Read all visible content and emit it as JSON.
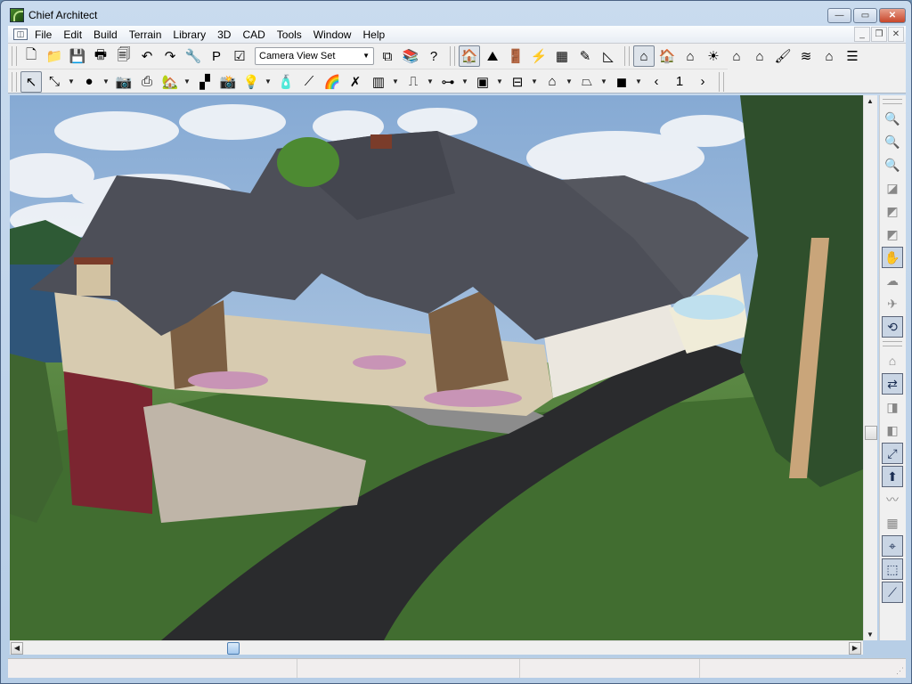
{
  "window": {
    "title": "Chief Architect",
    "controls": {
      "minimize": "—",
      "maximize": "▭",
      "close": "✕"
    }
  },
  "menubar": {
    "system_icon": "◫",
    "items": [
      "File",
      "Edit",
      "Build",
      "Terrain",
      "Library",
      "3D",
      "CAD",
      "Tools",
      "Window",
      "Help"
    ],
    "mdi_controls": {
      "minimize": "_",
      "restore": "❐",
      "close": "✕"
    }
  },
  "toolbar_row1": {
    "left_tools": [
      {
        "name": "new-plan",
        "glyph": "🗋"
      },
      {
        "name": "open-plan",
        "glyph": "📁"
      },
      {
        "name": "save",
        "glyph": "💾"
      },
      {
        "name": "print",
        "glyph": "🖶"
      },
      {
        "name": "print-preview",
        "glyph": "🗐"
      },
      {
        "name": "undo",
        "glyph": "↶"
      },
      {
        "name": "redo",
        "glyph": "↷"
      },
      {
        "name": "preferences",
        "glyph": "🔧"
      },
      {
        "name": "plan-layout",
        "glyph": "P"
      },
      {
        "name": "checklist",
        "glyph": "☑"
      }
    ],
    "view_set_combo": "Camera View Set",
    "combo_arrow": "▼",
    "after_combo": [
      {
        "name": "layer-display",
        "glyph": "⧉"
      },
      {
        "name": "library-browser",
        "glyph": "📚"
      },
      {
        "name": "help",
        "glyph": "?"
      }
    ],
    "build_tools": [
      {
        "name": "floor-plan",
        "glyph": "🏠",
        "selected": true
      },
      {
        "name": "terrain-plan",
        "glyph": "⛰"
      },
      {
        "name": "cabinet-plan",
        "glyph": "🚪"
      },
      {
        "name": "electrical-plan",
        "glyph": "⚡"
      },
      {
        "name": "materials-plan",
        "glyph": "▦"
      },
      {
        "name": "cad-plan",
        "glyph": "✎"
      },
      {
        "name": "cad-detail",
        "glyph": "◺"
      }
    ],
    "view_tools": [
      {
        "name": "camera-view",
        "glyph": "⌂",
        "selected": true
      },
      {
        "name": "full-overview",
        "glyph": "🏠"
      },
      {
        "name": "glass-house",
        "glyph": "⌂"
      },
      {
        "name": "raytrace-view",
        "glyph": "☀"
      },
      {
        "name": "doll-house",
        "glyph": "⌂"
      },
      {
        "name": "elevation-view",
        "glyph": "⌂"
      },
      {
        "name": "render-paint",
        "glyph": "🖌"
      },
      {
        "name": "water-render",
        "glyph": "≋"
      },
      {
        "name": "line-drawing",
        "glyph": "⌂"
      },
      {
        "name": "materials-list",
        "glyph": "☰"
      }
    ]
  },
  "toolbar_row2": {
    "tools": [
      {
        "name": "select-objects",
        "glyph": "↖",
        "selected": true
      },
      {
        "name": "edit-tools",
        "glyph": "⤡",
        "dropdown": true
      },
      {
        "name": "color-material",
        "glyph": "●",
        "dropdown": true
      },
      {
        "name": "camera-save",
        "glyph": "📷"
      },
      {
        "name": "printer-setup",
        "glyph": "⎙"
      },
      {
        "name": "house-tools",
        "glyph": "🏡",
        "dropdown": true
      },
      {
        "name": "blocks",
        "glyph": "▞"
      },
      {
        "name": "camera",
        "glyph": "📸"
      },
      {
        "name": "light",
        "glyph": "💡",
        "dropdown": true
      },
      {
        "name": "spray-paint",
        "glyph": "🧴"
      },
      {
        "name": "eyedropper",
        "glyph": "⟋"
      },
      {
        "name": "rainbow",
        "glyph": "🌈"
      },
      {
        "name": "no-material",
        "glyph": "✗"
      },
      {
        "name": "wall-tools",
        "glyph": "▥",
        "dropdown": true
      },
      {
        "name": "door-tools",
        "glyph": "⎍",
        "dropdown": true
      },
      {
        "name": "railing-tools",
        "glyph": "⊶",
        "dropdown": true
      },
      {
        "name": "cabinet-tools",
        "glyph": "▣",
        "dropdown": true
      },
      {
        "name": "electrical-tools",
        "glyph": "⊟",
        "dropdown": true
      },
      {
        "name": "roof-tools",
        "glyph": "⌂",
        "dropdown": true
      },
      {
        "name": "slab-tools",
        "glyph": "⏢",
        "dropdown": true
      },
      {
        "name": "3d-box-tools",
        "glyph": "◼",
        "dropdown": true
      },
      {
        "name": "previous",
        "glyph": "‹"
      },
      {
        "name": "floor-indicator",
        "glyph": "1"
      },
      {
        "name": "next",
        "glyph": "›"
      }
    ],
    "dropdown_glyph": "▼"
  },
  "viewport": {
    "description": "3D camera view of a house with grey shingle roof, driveway, lawn and trees"
  },
  "right_toolbar": {
    "tools": [
      {
        "name": "zoom-window",
        "glyph": "🔍",
        "enabled": false
      },
      {
        "name": "zoom-in",
        "glyph": "🔍",
        "enabled": false
      },
      {
        "name": "zoom-out",
        "glyph": "🔍",
        "enabled": false
      },
      {
        "name": "fill-window",
        "glyph": "◪",
        "enabled": false
      },
      {
        "name": "fill-window-building",
        "glyph": "◩",
        "enabled": false
      },
      {
        "name": "fill-window-all",
        "glyph": "◩",
        "enabled": false
      },
      {
        "name": "pan",
        "glyph": "✋",
        "enabled": true
      },
      {
        "name": "walkthrough-1",
        "glyph": "☁",
        "enabled": false
      },
      {
        "name": "walkthrough-2",
        "glyph": "✈",
        "enabled": false
      },
      {
        "name": "undo-zoom",
        "glyph": "⟲",
        "enabled": true
      },
      {
        "name": "walls-off",
        "glyph": "⌂",
        "enabled": false
      },
      {
        "name": "toggle-ceiling",
        "glyph": "⇄",
        "enabled": true
      },
      {
        "name": "cross-section",
        "glyph": "◨",
        "enabled": false
      },
      {
        "name": "backclip",
        "glyph": "◧",
        "enabled": false
      },
      {
        "name": "text-dimension",
        "glyph": "⤢",
        "enabled": true
      },
      {
        "name": "move-up",
        "glyph": "⬆",
        "enabled": true
      },
      {
        "name": "swirl",
        "glyph": "〰",
        "enabled": false
      },
      {
        "name": "grid",
        "glyph": "▦",
        "enabled": false
      },
      {
        "name": "snap-grid",
        "glyph": "⌖",
        "enabled": true
      },
      {
        "name": "object-snap",
        "glyph": "⬚",
        "enabled": true
      },
      {
        "name": "angle-snap",
        "glyph": "⟋",
        "enabled": true
      }
    ]
  },
  "scrollbars": {
    "vertical": {
      "up": "▲",
      "down": "▼",
      "position_fraction": 0.63
    },
    "horizontal": {
      "left": "◀",
      "right": "▶",
      "position_fraction": 0.25
    }
  },
  "statusbar": {
    "panes": [
      "",
      "",
      "",
      ""
    ],
    "resize_grip": "⋰"
  },
  "colors": {
    "title_bar": "#b6cde6",
    "toolbar_bg": "#f0f0f0",
    "sky": "#8fb2d8",
    "roof": "#4d4f58",
    "lawn": "#3f6a2e",
    "driveway": "#2b2c2d",
    "close_button": "#c8462a"
  }
}
